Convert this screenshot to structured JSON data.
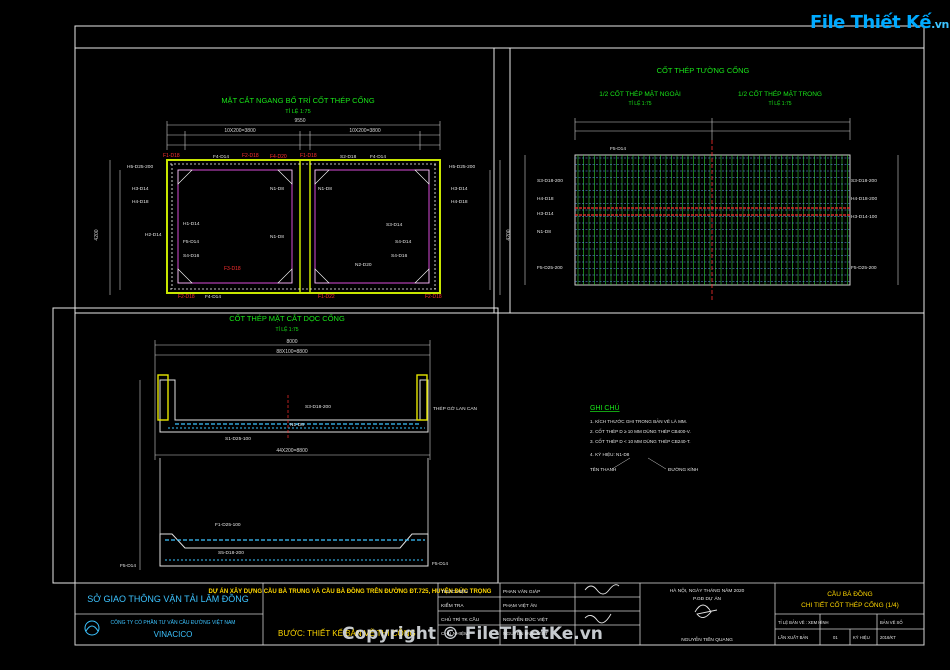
{
  "logo": {
    "text": "File Thiết Kế",
    "suffix": ".vn"
  },
  "watermark": "Copyright © FileThietKe.vn",
  "sheet_a": {
    "title": "MẶT CẮT NGANG BỐ TRÍ CỐT THÉP CỐNG",
    "scale": "TỈ LỆ 1:75",
    "labels_red": [
      "F1-D18",
      "F2-D18",
      "F1-D18",
      "F3-D18",
      "F2-D18",
      "F1-D22",
      "F4-D20",
      "F2-D18"
    ],
    "labels_white": [
      "H5-D25-200",
      "H5-D25-200",
      "H3-D14",
      "H4-D18",
      "H2-D14",
      "H1-D14",
      "H3-D14",
      "H4-D18",
      "F5-D14",
      "F4-D14",
      "F4-D14",
      "S2-D18",
      "F4-D14",
      "S4-D16",
      "S4-D14",
      "S3-D14",
      "S4-D16",
      "N1-D8",
      "N1-D8",
      "N2-D20",
      "N1-D8"
    ]
  },
  "sheet_b": {
    "title": "CỐT THÉP TƯỜNG CỐNG",
    "left_title": "1/2 CỐT THÉP MẶT NGOÀI",
    "right_title": "1/2 CỐT THÉP MẶT TRONG",
    "scale_left": "TỈ LỆ 1:75",
    "scale_right": "TỈ LỆ 1:75",
    "side_labels": [
      "S3-D18-200",
      "H4-D18",
      "H3-D14",
      "N1-D8",
      "F5-D14",
      "F5-D25-200",
      "S3-D18-200",
      "H4-D18-200",
      "H3-D14-100",
      "F5-D25-200"
    ]
  },
  "sheet_c": {
    "title": "CỐT THÉP MẶT CẮT DỌC CỐNG",
    "scale": "TỈ LỆ 1:75",
    "labels": [
      "S3-D18-200",
      "THÉP GỜ LAN CAN",
      "N1-D8",
      "S1-D25-100",
      "F1-D25-100",
      "S5-D18-200",
      "F5-D14",
      "F5-D14"
    ],
    "dims": [
      "8000",
      "88X100=8800",
      "44X200=8800"
    ]
  },
  "notes": {
    "heading": "GHI CHÚ",
    "lines": [
      "1. KÍCH THƯỚC GHI TRONG BẢN VẼ LÀ MM.",
      "2. CỐT THÉP D ≥ 10 MM DÙNG THÉP CB400-V.",
      "3. CỐT THÉP D < 10 MM DÙNG THÉP CB240-T.",
      "4. KÝ HIỆU:      N1-D8"
    ],
    "legend_left": "TÊN THANH",
    "legend_right": "ĐƯỜNG KÍNH"
  },
  "title_block": {
    "agency": "SỞ GIAO THÔNG VẬN TẢI LÂM ĐỒNG",
    "company_line1": "CÔNG TY CỔ PHẦN TƯ VẤN CẦU ĐƯỜNG VIỆT NAM",
    "company_name": "VINACICO",
    "project": "DỰ ÁN XÂY DỰNG CẦU BÀ TRUNG VÀ CẦU BÀ ĐỒNG TRÊN ĐƯỜNG ĐT.725, HUYỆN ĐỨC TRỌNG",
    "stage": "BƯỚC: THIẾT KẾ BẢN VẼ THI CÔNG",
    "roles": [
      "THỰC HIỆN",
      "KIỂM TRA",
      "CHỦ TRÌ TK CẦU",
      "CHỦ NHIỆM"
    ],
    "names": [
      "PHAN VĂN GIÁP",
      "PHẠM VIỆT ÂN",
      "NGUYỄN ĐỨC VIỆT",
      "NGUYỄN ĐỨC VIỆT"
    ],
    "date_line": "HÀ NỘI, NGÀY  THÁNG  NĂM 2020",
    "director_role": "P.GĐ DỰ ÁN",
    "director": "NGUYỄN TIẾN QUANG",
    "drawing_title_1": "CẦU BÀ ĐỒNG",
    "drawing_title_2": "CHI TIẾT CỐT THÉP CỐNG (1/4)",
    "meta_labels": [
      "TỈ LỆ BẢN VẼ : XEM HÌNH",
      "BẢN VẼ SỐ",
      "LẦN XUẤT BẢN",
      "01",
      "KÝ HIỆU",
      "2016/KT"
    ]
  }
}
